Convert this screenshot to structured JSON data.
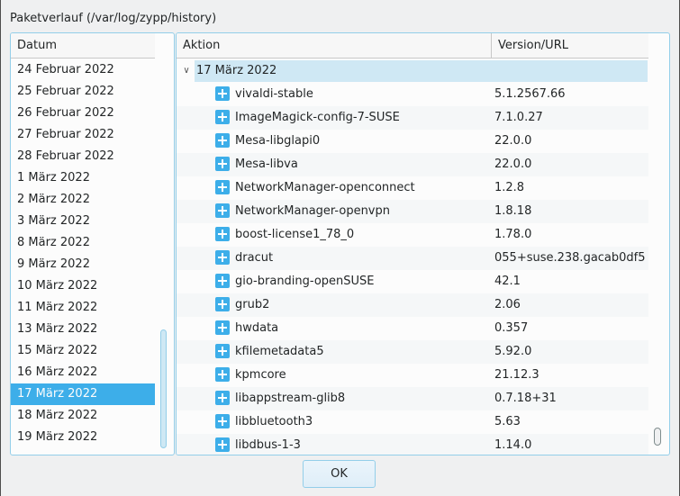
{
  "dialog": {
    "title": "Paketverlauf (/var/log/zypp/history)"
  },
  "left_list": {
    "header": "Datum",
    "items": [
      {
        "label": "24 Februar 2022"
      },
      {
        "label": "25 Februar 2022"
      },
      {
        "label": "26 Februar 2022"
      },
      {
        "label": "27 Februar 2022"
      },
      {
        "label": "28 Februar 2022"
      },
      {
        "label": "1 März 2022"
      },
      {
        "label": "2 März 2022"
      },
      {
        "label": "3 März 2022"
      },
      {
        "label": "8 März 2022"
      },
      {
        "label": "9 März 2022"
      },
      {
        "label": "10 März 2022"
      },
      {
        "label": "11 März 2022"
      },
      {
        "label": "13 März 2022"
      },
      {
        "label": "15 März 2022"
      },
      {
        "label": "16 März 2022"
      },
      {
        "label": "17 März 2022",
        "selected": true
      },
      {
        "label": "18 März 2022"
      },
      {
        "label": "19 März 2022"
      }
    ]
  },
  "right_table": {
    "columns": [
      "Aktion",
      "Version/URL"
    ],
    "group": "17 März 2022",
    "rows": [
      {
        "name": "vivaldi-stable",
        "version": "5.1.2567.66",
        "icon": "install-plus-icon"
      },
      {
        "name": "ImageMagick-config-7-SUSE",
        "version": "7.1.0.27",
        "icon": "install-plus-icon"
      },
      {
        "name": "Mesa-libglapi0",
        "version": "22.0.0",
        "icon": "install-plus-icon"
      },
      {
        "name": "Mesa-libva",
        "version": "22.0.0",
        "icon": "install-plus-icon"
      },
      {
        "name": "NetworkManager-openconnect",
        "version": "1.2.8",
        "icon": "install-plus-icon"
      },
      {
        "name": "NetworkManager-openvpn",
        "version": "1.8.18",
        "icon": "install-plus-icon"
      },
      {
        "name": "boost-license1_78_0",
        "version": "1.78.0",
        "icon": "install-plus-icon"
      },
      {
        "name": "dracut",
        "version": "055+suse.238.gacab0df5",
        "icon": "install-plus-icon"
      },
      {
        "name": "gio-branding-openSUSE",
        "version": "42.1",
        "icon": "install-plus-icon"
      },
      {
        "name": "grub2",
        "version": "2.06",
        "icon": "install-plus-icon"
      },
      {
        "name": "hwdata",
        "version": "0.357",
        "icon": "install-plus-icon"
      },
      {
        "name": "kfilemetadata5",
        "version": "5.92.0",
        "icon": "install-plus-icon"
      },
      {
        "name": "kpmcore",
        "version": "21.12.3",
        "icon": "install-plus-icon"
      },
      {
        "name": "libappstream-glib8",
        "version": "0.7.18+31",
        "icon": "install-plus-icon"
      },
      {
        "name": "libbluetooth3",
        "version": "5.63",
        "icon": "install-plus-icon"
      },
      {
        "name": "libdbus-1-3",
        "version": "1.14.0",
        "icon": "install-plus-icon"
      }
    ]
  },
  "footer": {
    "ok_label": "OK"
  },
  "colors": {
    "accent": "#3daee9",
    "selection_light": "#cfe8f4",
    "frame": "#93cee9"
  }
}
